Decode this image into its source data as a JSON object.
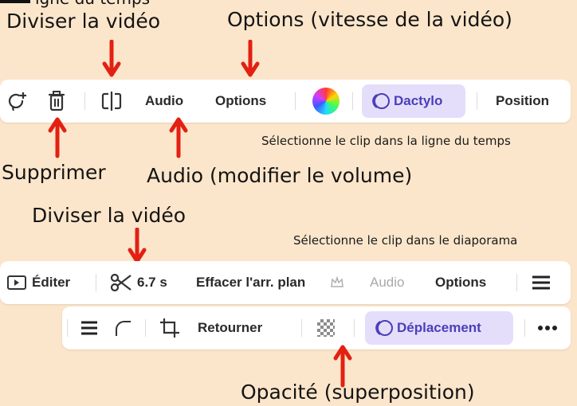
{
  "header": {
    "partial_text": "igne du temps"
  },
  "labels": {
    "split_video_top": "Diviser la vidéo",
    "options_top": "Options (vitesse de la vidéo)",
    "instruction_timeline": "Sélectionne le clip dans la ligne du temps",
    "delete": "Supprimer",
    "audio_volume": "Audio (modifier le volume)",
    "split_video_mid": "Diviser la vidéo",
    "instruction_slideshow": "Sélectionne le clip dans le diaporama",
    "opacity": "Opacité (superposition)"
  },
  "toolbar_timeline": {
    "audio": "Audio",
    "options": "Options",
    "dactylo": "Dactylo",
    "position": "Position"
  },
  "toolbar_slideshow_1": {
    "edit": "Éditer",
    "duration": "6.7 s",
    "remove_bg": "Effacer l'arr. plan",
    "audio": "Audio",
    "options": "Options"
  },
  "toolbar_slideshow_2": {
    "flip": "Retourner",
    "move": "Déplacement"
  },
  "colors": {
    "background": "#FCE6CB",
    "arrow": "#E32012",
    "accent_pill": "#E4DEFB",
    "accent_text": "#4A3FB8"
  }
}
